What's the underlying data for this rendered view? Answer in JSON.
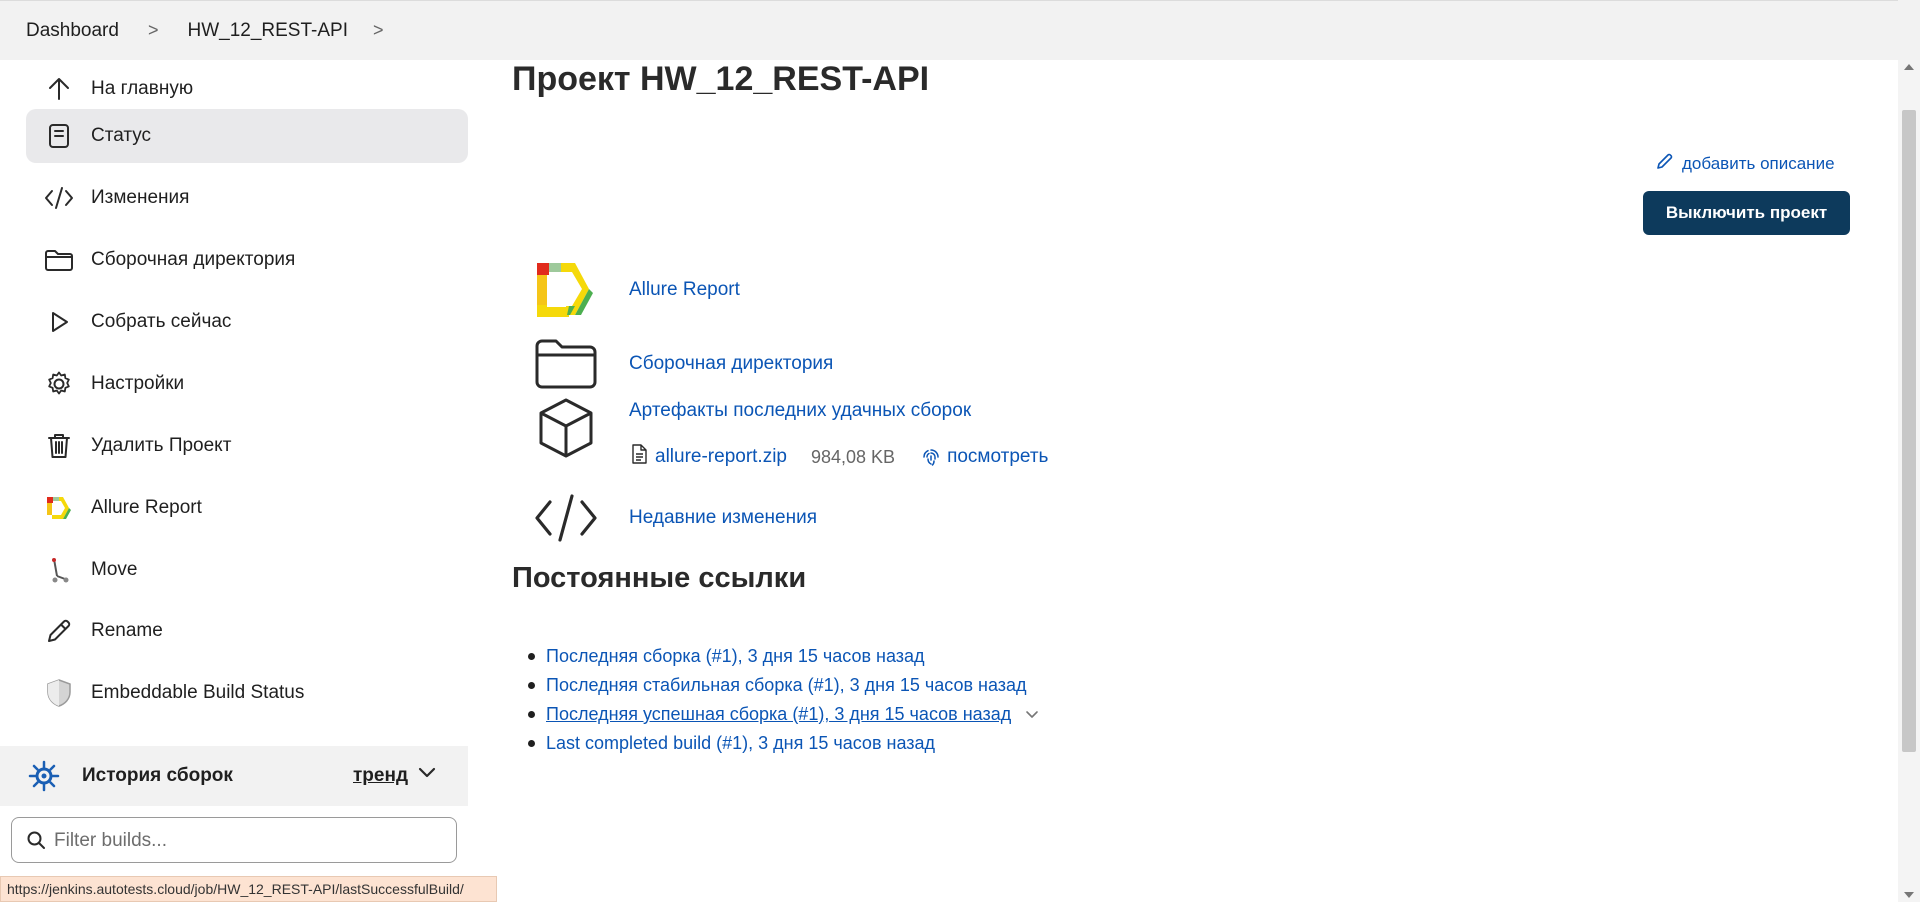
{
  "breadcrumb": {
    "items": [
      "Dashboard",
      "HW_12_REST-API"
    ],
    "separator": ">"
  },
  "sidebar": {
    "items": [
      {
        "label": "На главную",
        "icon": "arrow-up-icon"
      },
      {
        "label": "Статус",
        "icon": "document-icon",
        "active": true
      },
      {
        "label": "Изменения",
        "icon": "code-icon"
      },
      {
        "label": "Сборочная директория",
        "icon": "folder-icon"
      },
      {
        "label": "Собрать сейчас",
        "icon": "play-icon"
      },
      {
        "label": "Настройки",
        "icon": "gear-icon"
      },
      {
        "label": "Удалить Проект",
        "icon": "trash-icon"
      },
      {
        "label": "Allure Report",
        "icon": "allure-icon"
      },
      {
        "label": "Move",
        "icon": "move-icon"
      },
      {
        "label": "Rename",
        "icon": "pencil-icon"
      },
      {
        "label": "Embeddable Build Status",
        "icon": "shield-icon"
      }
    ],
    "history": {
      "title": "История сборок",
      "trend": "тренд"
    },
    "filter": {
      "placeholder": "Filter builds...",
      "value": ""
    }
  },
  "statusbar": {
    "url": "https://jenkins.autotests.cloud/job/HW_12_REST-API/lastSuccessfulBuild/"
  },
  "main": {
    "title": "Проект HW_12_REST-API",
    "add_description": "добавить описание",
    "disable_button": "Выключить проект",
    "tasks": [
      {
        "label": "Allure Report",
        "icon": "allure-icon"
      },
      {
        "label": "Сборочная директория",
        "icon": "folder-icon"
      },
      {
        "label": "Артефакты последних удачных сборок",
        "icon": "box-icon"
      },
      {
        "label": "Недавние изменения",
        "icon": "code-icon"
      }
    ],
    "artifact": {
      "file": "allure-report.zip",
      "size": "984,08 KB",
      "view": "посмотреть"
    },
    "permalinks": {
      "title": "Постоянные ссылки",
      "items": [
        "Последняя сборка (#1), 3 дня 15 часов назад",
        "Последняя стабильная сборка (#1), 3 дня 15 часов назад",
        "Последняя успешная сборка (#1), 3 дня 15 часов назад",
        "Last completed build (#1), 3 дня 15 часов назад"
      ]
    }
  },
  "colors": {
    "link": "#0b55b5",
    "button_bg": "#0d3a5c",
    "sidebar_active": "#e9e9eb",
    "header_bg": "#f2f2f2"
  }
}
